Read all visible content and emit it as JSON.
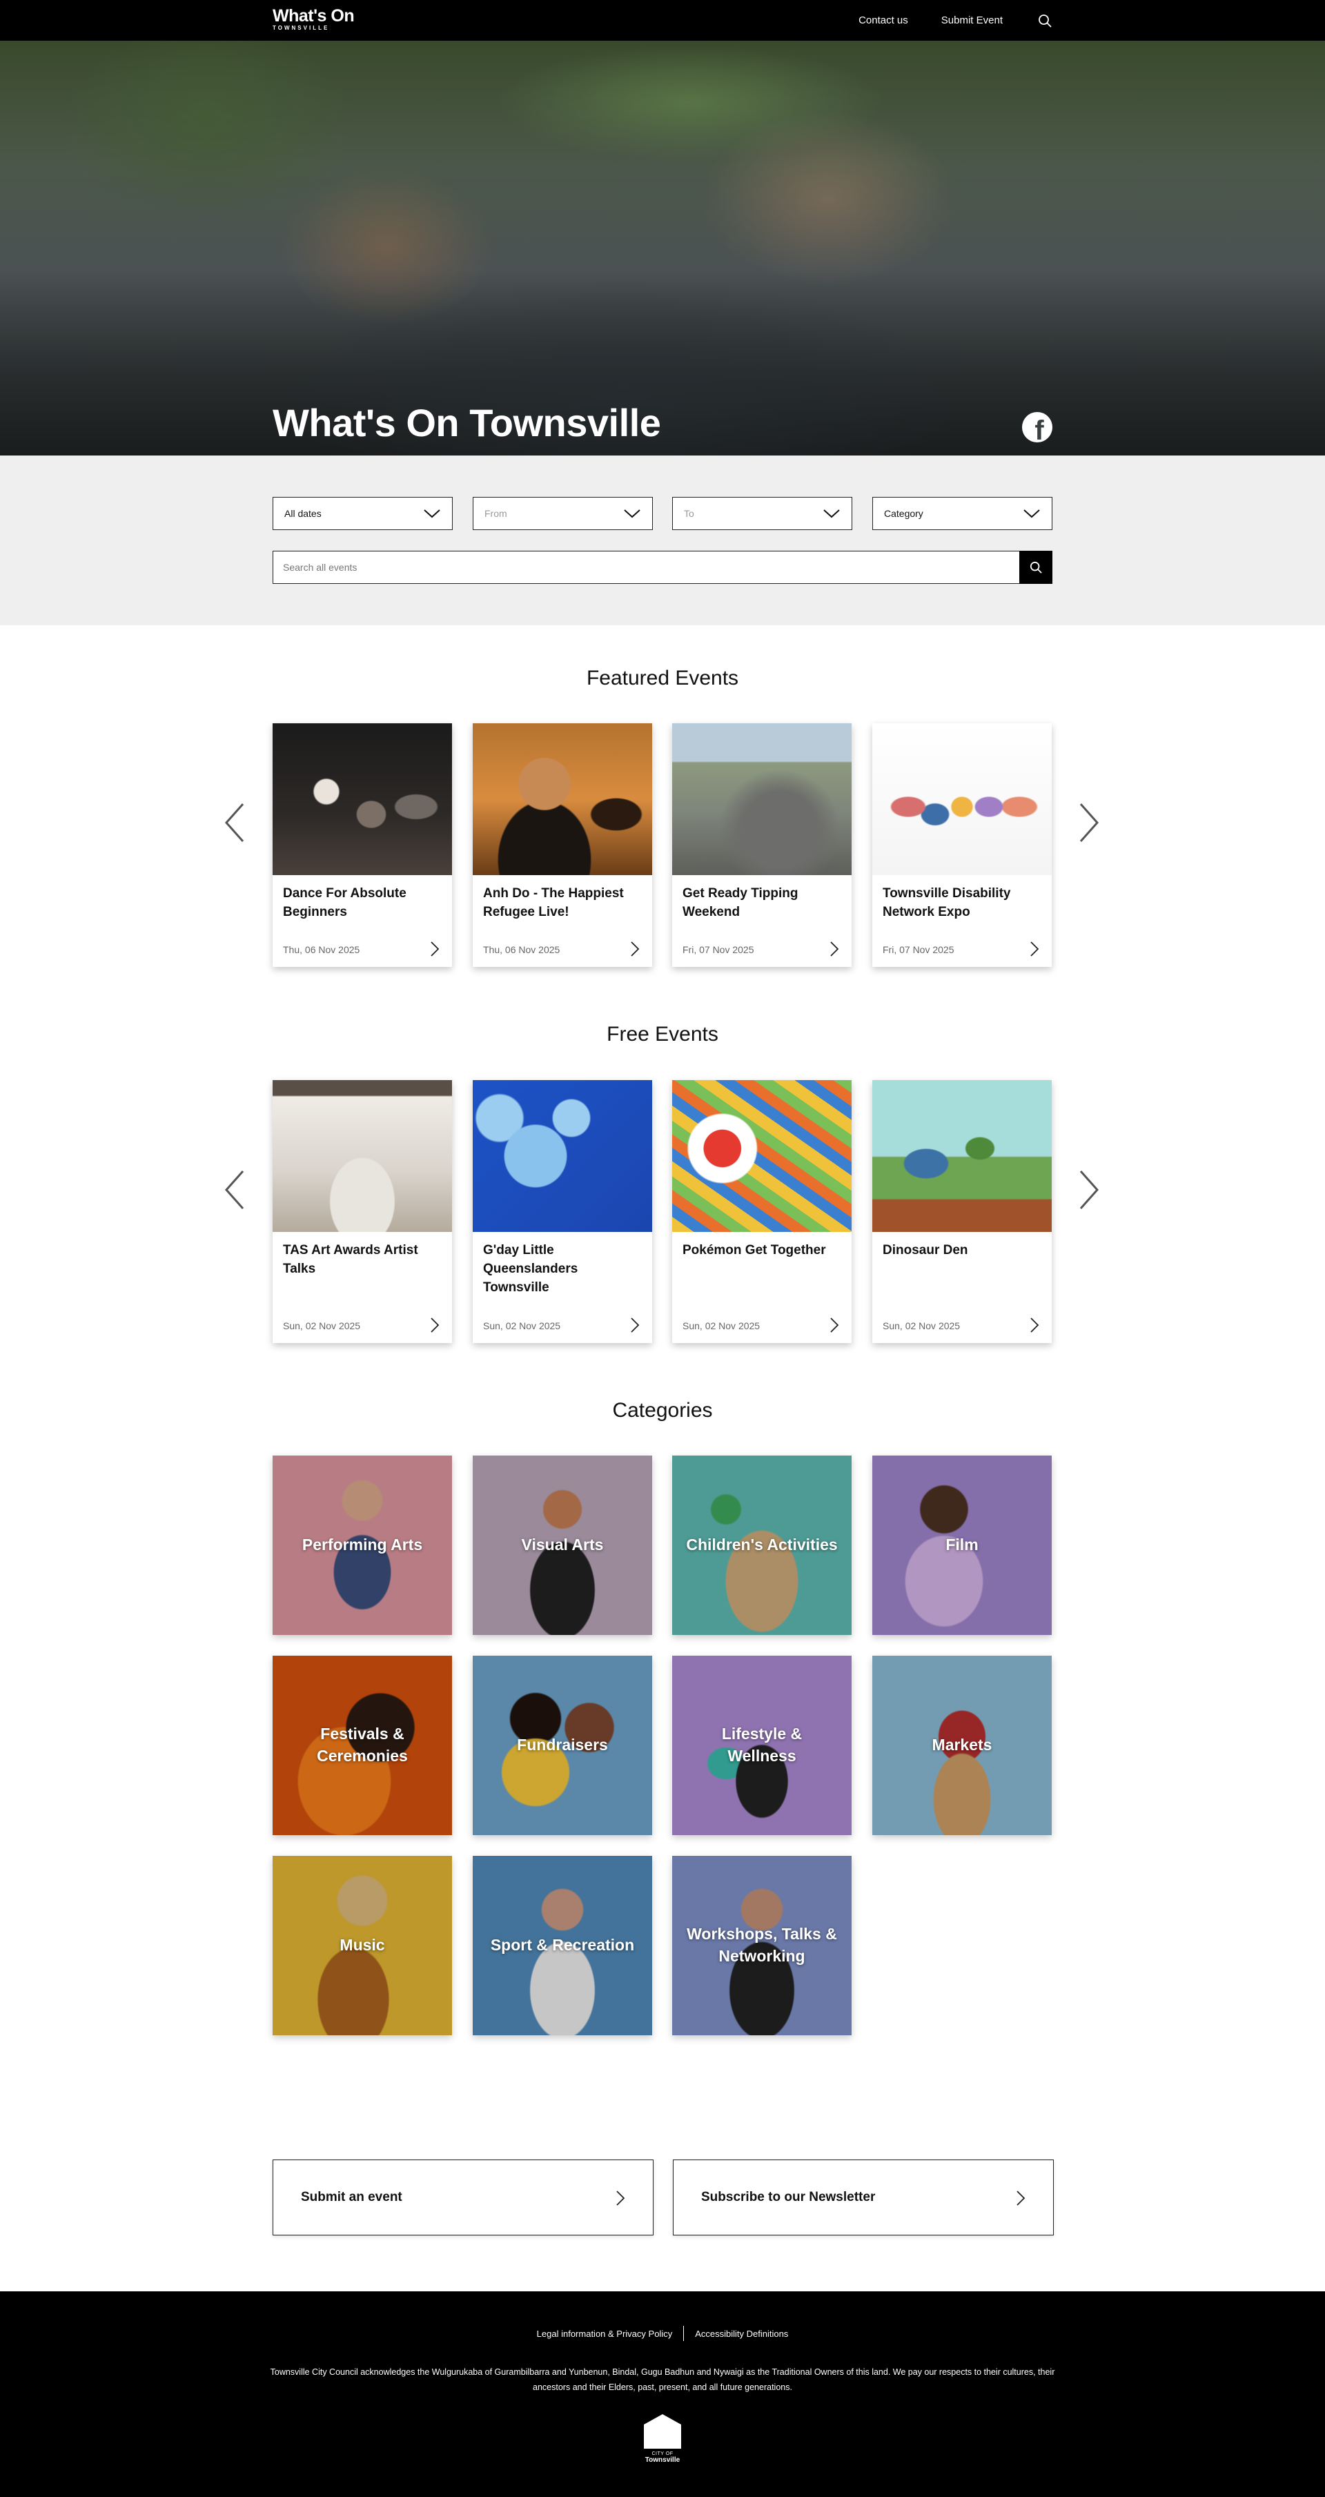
{
  "header": {
    "logo_main": "What's On",
    "logo_sub": "TOWNSVILLE",
    "nav": [
      "Contact us",
      "Submit Event"
    ],
    "search_icon": "search-icon"
  },
  "hero": {
    "title": "What's On Townsville",
    "social_icon": "facebook-icon",
    "social_glyph": "f"
  },
  "filters": {
    "dates": "All dates",
    "from": "From",
    "to": "To",
    "category": "Category",
    "search_placeholder": "Search all events"
  },
  "featured": {
    "title": "Featured Events",
    "events": [
      {
        "title": "Dance For Absolute Beginners",
        "date": "Thu, 06 Nov 2025"
      },
      {
        "title": "Anh Do - The Happiest Refugee Live!",
        "date": "Thu, 06 Nov 2025"
      },
      {
        "title": "Get Ready Tipping Weekend",
        "date": "Fri, 07 Nov 2025"
      },
      {
        "title": "Townsville Disability Network Expo",
        "date": "Fri, 07 Nov 2025"
      }
    ]
  },
  "free": {
    "title": "Free Events",
    "events": [
      {
        "title": "TAS Art Awards Artist Talks",
        "date": "Sun, 02 Nov 2025"
      },
      {
        "title": "G'day Little Queenslanders Townsville",
        "date": "Sun, 02 Nov 2025"
      },
      {
        "title": "Pokémon Get Together",
        "date": "Sun, 02 Nov 2025"
      },
      {
        "title": "Dinosaur Den",
        "date": "Sun, 02 Nov 2025"
      }
    ]
  },
  "categories": {
    "title": "Categories",
    "items": [
      "Performing Arts",
      "Visual Arts",
      "Children's Activities",
      "Film",
      "Festivals & Ceremonies",
      "Fundraisers",
      "Lifestyle & Wellness",
      "Markets",
      "Music",
      "Sport & Recreation",
      "Workshops, Talks & Networking"
    ]
  },
  "cta": {
    "submit": "Submit an event",
    "subscribe": "Subscribe to our Newsletter"
  },
  "footer": {
    "links": [
      "Legal information & Privacy Policy",
      "Accessibility Definitions"
    ],
    "acknowledgement": "Townsville City Council acknowledges the Wulgurukaba of Gurambilbarra and Yunbenun, Bindal, Gugu Badhun and Nywaigi as the Traditional Owners of this land. We pay our respects to their cultures, their ancestors and their Elders, past, present, and all future generations.",
    "logo_line1": "CITY OF",
    "logo_line2": "Townsville"
  }
}
